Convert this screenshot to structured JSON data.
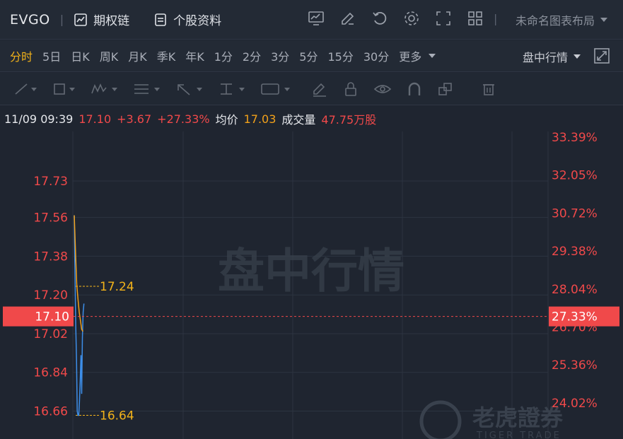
{
  "header": {
    "ticker": "EVGO",
    "options_chain": "期权链",
    "stock_profile": "个股资料",
    "layout_name": "未命名图表布局"
  },
  "timeframes": {
    "items": [
      "分时",
      "5日",
      "日K",
      "周K",
      "月K",
      "季K",
      "年K",
      "1分",
      "2分",
      "3分",
      "5分",
      "15分",
      "30分"
    ],
    "more": "更多",
    "realtime": "盘中行情"
  },
  "quote": {
    "datetime": "11/09 09:39",
    "price": "17.10",
    "change": "+3.67",
    "change_pct": "+27.33%",
    "avg_label": "均价",
    "avg_value": "17.03",
    "volume_label": "成交量",
    "volume_value": "47.75万股"
  },
  "colors": {
    "up": "#f0494a",
    "avg_line": "#f2a11a",
    "price_line": "#3d8ee8",
    "active_tab": "#f2b21a"
  },
  "chart_data": {
    "type": "line",
    "left_axis_labels": [
      "17.73",
      "17.56",
      "17.38",
      "17.20",
      "17.02",
      "16.84",
      "16.66"
    ],
    "right_axis_labels": [
      "33.39%",
      "32.05%",
      "30.72%",
      "29.38%",
      "28.04%",
      "26.70%",
      "25.36%",
      "24.02%"
    ],
    "current_price_label": "17.10",
    "current_pct_label": "27.33%",
    "ylim": [
      16.53,
      17.96
    ],
    "watermark": "盘中行情",
    "brand_watermark": "老虎證券",
    "brand_sub": "TIGER TRADE",
    "high_marker": {
      "label": "17.24",
      "value": 17.24
    },
    "low_marker": {
      "label": "16.64",
      "value": 16.64
    },
    "current_value": 17.1,
    "series": [
      {
        "values": [
          17.57,
          17.3,
          17.06,
          16.9,
          16.66,
          16.64,
          16.64,
          16.7,
          16.8,
          16.92,
          16.74,
          17.0,
          17.12,
          17.16
        ]
      },
      {
        "values": [
          17.57,
          17.4,
          17.25,
          17.18,
          17.12,
          17.08,
          17.04,
          17.03
        ]
      }
    ]
  }
}
